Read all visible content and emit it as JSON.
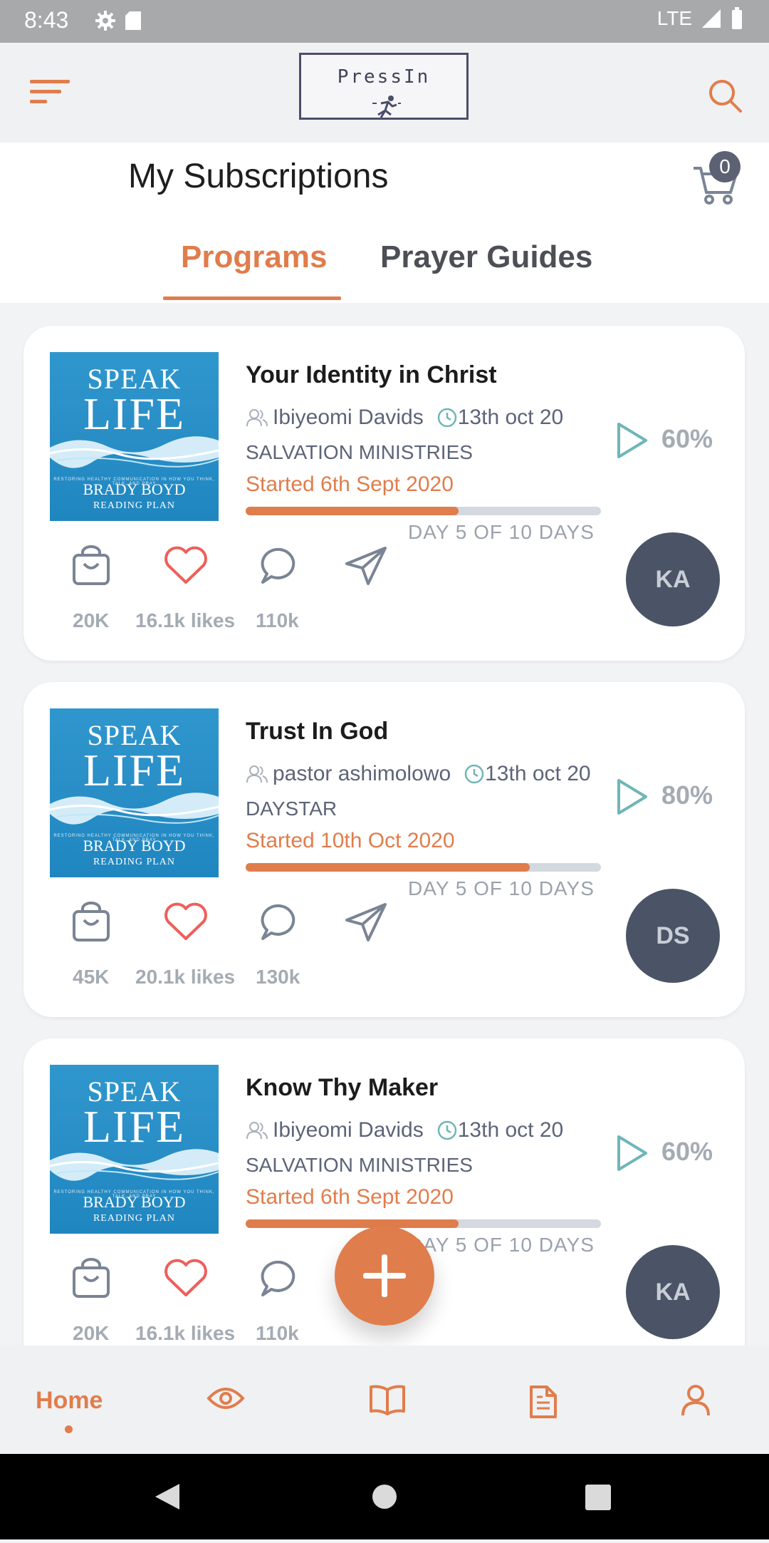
{
  "status_bar": {
    "time": "8:43",
    "network": "LTE"
  },
  "app": {
    "logo_text": "PressIn",
    "page_title": "My Subscriptions",
    "cart_count": "0"
  },
  "tabs": [
    {
      "label": "Programs",
      "active": true
    },
    {
      "label": "Prayer Guides",
      "active": false
    }
  ],
  "cover": {
    "line1": "SPEAK",
    "line2": "LIFE",
    "fine": "RESTORING HEALTHY COMMUNICATION IN HOW YOU THINK, TALK, AND PRAY",
    "author": "BRADY BOYD",
    "subtitle": "READING PLAN"
  },
  "programs": [
    {
      "title": "Your Identity in Christ",
      "author": "Ibiyeomi Davids",
      "date": "13th oct 20",
      "ministry": "SALVATION MINISTRIES",
      "started": "Started 6th Sept 2020",
      "progress": 0.6,
      "day": "DAY 5 OF 10 DAYS",
      "percent": "60%",
      "initials": "KA",
      "counts": {
        "bag": "20K",
        "likes": "16.1k likes",
        "comments": "110k"
      }
    },
    {
      "title": "Trust In God",
      "author": "pastor ashimolowo",
      "date": "13th oct 20",
      "ministry": "DAYSTAR",
      "started": "Started 10th Oct 2020",
      "progress": 0.8,
      "day": "DAY 5 OF 10 DAYS",
      "percent": "80%",
      "initials": "DS",
      "counts": {
        "bag": "45K",
        "likes": "20.1k likes",
        "comments": "130k"
      }
    },
    {
      "title": "Know Thy Maker",
      "author": "Ibiyeomi Davids",
      "date": "13th oct 20",
      "ministry": "SALVATION MINISTRIES",
      "started": "Started 6th Sept 2020",
      "progress": 0.6,
      "day": "DAY 5 OF 10 DAYS",
      "percent": "60%",
      "initials": "KA",
      "counts": {
        "bag": "20K",
        "likes": "16.1k likes",
        "comments": "110k"
      }
    }
  ],
  "bottom_nav": {
    "home_label": "Home",
    "icons": [
      "eye-icon",
      "book-icon",
      "document-icon",
      "user-icon"
    ]
  },
  "colors": {
    "accent": "#e07d4c",
    "avatar_bg": "#4a5466",
    "text_secondary": "#5c6478",
    "play_teal": "#6fb6b8"
  }
}
